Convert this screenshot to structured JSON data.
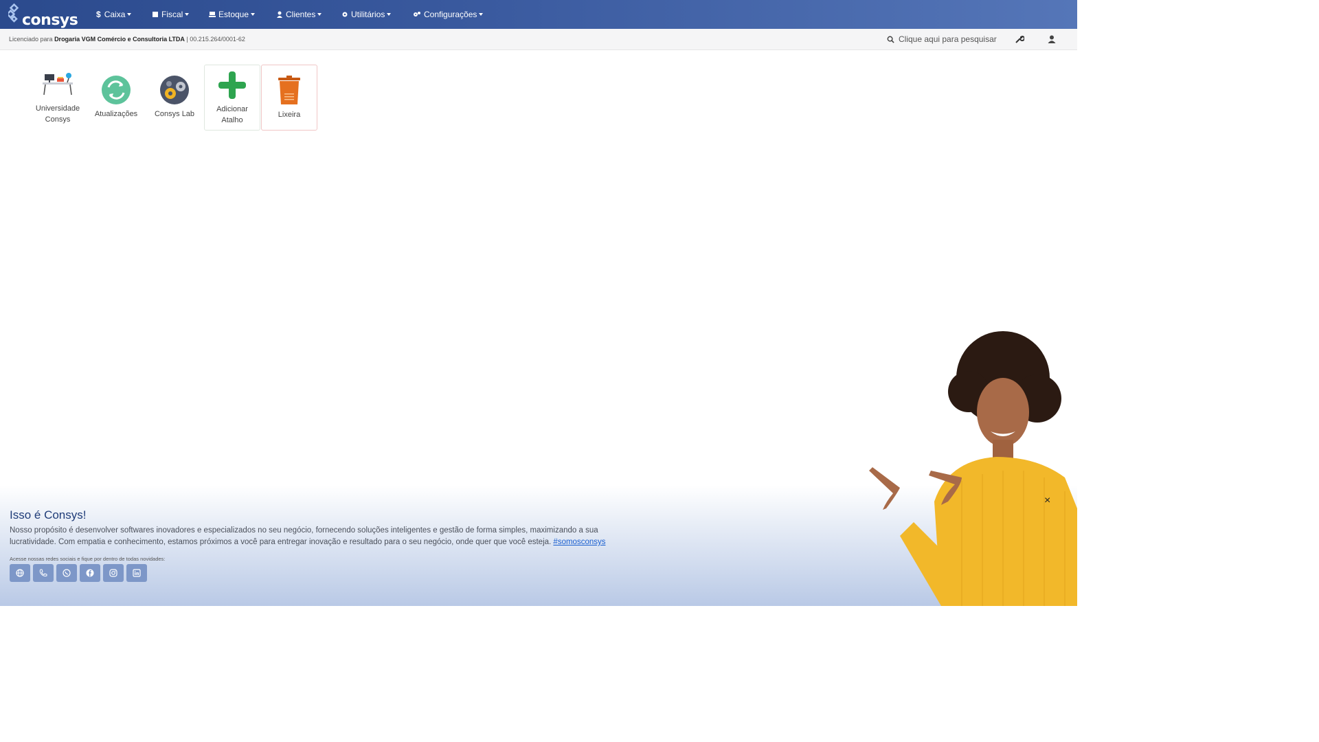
{
  "brand": {
    "logo_text": "consys"
  },
  "menu": [
    {
      "label": "Caixa",
      "icon": "dollar-icon"
    },
    {
      "label": "Fiscal",
      "icon": "document-icon"
    },
    {
      "label": "Estoque",
      "icon": "warehouse-icon"
    },
    {
      "label": "Clientes",
      "icon": "user-icon"
    },
    {
      "label": "Utilitários",
      "icon": "gear-icon"
    },
    {
      "label": "Configurações",
      "icon": "gears-icon"
    }
  ],
  "license": {
    "prefix": "Licenciado para",
    "company": "Drogaria VGM Comércio e Consultoria LTDA",
    "separator": "|",
    "cnpj": "00.215.264/0001-62"
  },
  "search": {
    "placeholder": "Clique aqui para pesquisar"
  },
  "shortcuts": [
    {
      "label_line1": "Universidade",
      "label_line2": "Consys"
    },
    {
      "label": "Atualizações"
    },
    {
      "label": "Consys Lab"
    },
    {
      "label_line1": "Adicionar",
      "label_line2": "Atalho"
    },
    {
      "label": "Lixeira"
    }
  ],
  "footer": {
    "title": "Isso é Consys!",
    "text": "Nosso propósito é desenvolver softwares inovadores e especializados no seu negócio, fornecendo soluções inteligentes e gestão de forma simples, maximizando a sua lucratividade. Com empatia e conhecimento, estamos próximos a você para entregar inovação e resultado para o seu negócio, onde quer que você esteja.",
    "hashtag": "#somosconsys",
    "social_note": "Acesse nossas redes sociais e fique por dentro de todas novidades:",
    "socials": [
      "globe-icon",
      "phone-icon",
      "whatsapp-icon",
      "facebook-icon",
      "instagram-icon",
      "linkedin-icon"
    ],
    "close": "×"
  },
  "colors": {
    "navbar": "#2b4a8d",
    "green": "#2ea44f",
    "orange": "#e5701f",
    "teal": "#5dc39b",
    "link": "#1a5fd0"
  }
}
